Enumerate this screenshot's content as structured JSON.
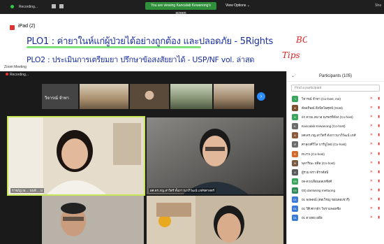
{
  "sharebar": {
    "recording_label": "Recording...",
    "viewing_label": "You are viewing Kancalab Kewanong's screen",
    "view_options": "View Options ⌄",
    "right_label": "Sha"
  },
  "ipad": {
    "title": "iPad (2)",
    "line1": "PLO1 : ค่ายาในห์แก่ผู้ป่วยได้อย่างถูกต้อง และปลอดภัย - 5Rights",
    "line2": "PLO2 : ประเมินการเตรียมยา ปรึกษาข้อสงสัยยาได้ - USP/NF vol. ล่าสุด",
    "bcd": "BCD",
    "tips": "Tips"
  },
  "zoom": {
    "window_title": "Zoom Meeting",
    "recording_label": "Recording...",
    "gallery_name": "วิจารณ์ จำทา",
    "next_arrow": "›"
  },
  "videos": {
    "v1_caption": "ราชภัฏ ณ ... นนท์ ... ม",
    "v2_caption": "ผศ.ดร.ภญ.สาวิตรี ตั้งภาวนาภิวัฒน์ เภสัชศาสตร์",
    "v3_caption": "",
    "v4_caption": ""
  },
  "participants": {
    "header": "Participants (105)",
    "search_placeholder": "Find a participant",
    "rows": [
      {
        "initial": "ว",
        "color": "#3aa55d",
        "name": "วิจารณ์ จำทา (Co-host, me)"
      },
      {
        "initial": "ด",
        "color": "#7b4f2c",
        "name": "ดัลลกิษณ์ ติ่งบิดโผศุทธ์ (Host)"
      },
      {
        "initial": "อ",
        "color": "#3aa55d",
        "name": "อว ดามเ ดมาอ ณรพรทิลังง (Co-host)"
      },
      {
        "initial": "K",
        "color": "#6b6b6b",
        "name": "Kancalab Kewanong (Co-host)"
      },
      {
        "initial": "ผ",
        "color": "#8a5a3c",
        "name": "ผศ.ดร.ภญ.สาวิตรี ตั้งภาวนาภิวัฒน์ เภสัช"
      },
      {
        "initial": "ศ",
        "color": "#6b6b6b",
        "name": "ศาสุงงศ์วิไล บาร์มูไดย (Co-host)"
      },
      {
        "initial": "R",
        "color": "#d36a2b",
        "name": "RUTS (Co-host)"
      },
      {
        "initial": "พ",
        "color": "#7a5a40",
        "name": "พุลาริณะ้ ยดิล (Co-host)"
      },
      {
        "initial": "ผ",
        "color": "#5a5a5a",
        "name": "ผู้ร่วม ทรา ดีราศ์สนี้"
      },
      {
        "initial": "09",
        "color": "#3aa55d",
        "name": "09-ดวงเลือนอลเทชิงศ์"
      },
      {
        "initial": "03",
        "color": "#2e8b57",
        "name": "03) danlusing mettuong"
      },
      {
        "initial": "01",
        "color": "#3a7bd5",
        "name": "01 พงษลณ์ (ต่อเวิชญ ขอนดอเชวรี)"
      },
      {
        "initial": "01",
        "color": "#3a7bd5",
        "name": "01 วิศิ ศกาด์ก วิจรามพอทชิง"
      },
      {
        "initial": "01",
        "color": "#3a7bd5",
        "name": "01 ตวงดย อดีอ"
      }
    ]
  }
}
